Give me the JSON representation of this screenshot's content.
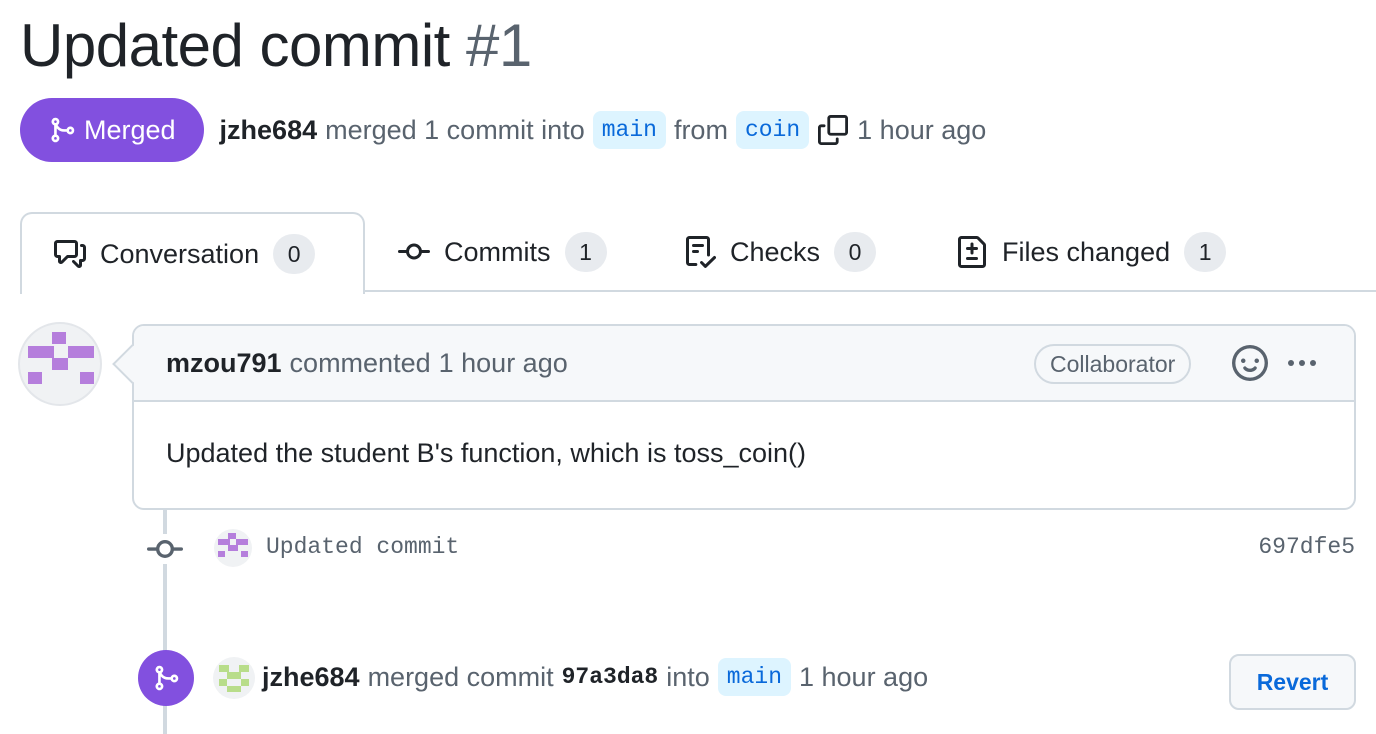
{
  "pr": {
    "title": "Updated commit",
    "number": "#1"
  },
  "meta": {
    "state": "Merged",
    "author": "jzhe684",
    "action": "merged 1 commit into",
    "base_branch": "main",
    "from_word": "from",
    "head_branch": "coin",
    "time": "1 hour ago"
  },
  "tabs": [
    {
      "label": "Conversation",
      "count": "0",
      "icon": "comment-discussion-icon"
    },
    {
      "label": "Commits",
      "count": "1",
      "icon": "git-commit-icon"
    },
    {
      "label": "Checks",
      "count": "0",
      "icon": "checklist-icon"
    },
    {
      "label": "Files changed",
      "count": "1",
      "icon": "file-diff-icon"
    }
  ],
  "comment": {
    "author": "mzou791",
    "action": "commented",
    "time": "1 hour ago",
    "role": "Collaborator",
    "body": "Updated the student B's function, which is toss_coin()"
  },
  "commit": {
    "message": "Updated commit",
    "sha": "697dfe5"
  },
  "merge_event": {
    "author": "jzhe684",
    "action": "merged commit",
    "sha": "97a3da8",
    "into_word": "into",
    "branch": "main",
    "time": "1 hour ago",
    "revert_label": "Revert"
  },
  "colors": {
    "merged_purple": "#8250df",
    "link_blue": "#0969da",
    "branch_bg": "#ddf4ff",
    "identicon_purple": "#b57edc",
    "identicon_green": "#b8dd8a"
  }
}
